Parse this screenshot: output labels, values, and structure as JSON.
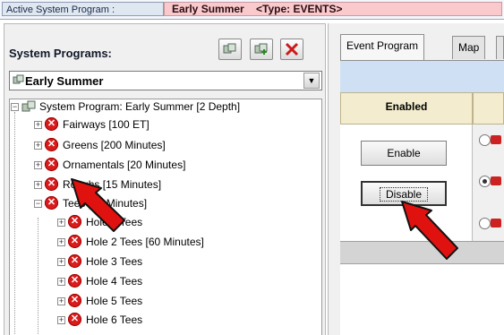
{
  "header": {
    "active_label": "Active System Program :",
    "active_value": "Early Summer    <Type: EVENTS>"
  },
  "left_panel": {
    "title": "System Programs:",
    "toolbar": [
      {
        "icon": "program-icon",
        "name": "view-program-button"
      },
      {
        "icon": "add-program-icon",
        "name": "add-program-button"
      },
      {
        "icon": "delete-x-icon",
        "name": "delete-program-button"
      }
    ],
    "selected_program": "Early Summer",
    "tree": [
      {
        "level": 0,
        "expander": "−",
        "icon": "program-icon",
        "text": "System Program: Early Summer  [2 Depth]"
      },
      {
        "level": 1,
        "expander": "+",
        "icon": "error-icon",
        "text": "Fairways  [100 ET]"
      },
      {
        "level": 1,
        "expander": "+",
        "icon": "error-icon",
        "text": "Greens  [200 Minutes]"
      },
      {
        "level": 1,
        "expander": "+",
        "icon": "error-icon",
        "text": "Ornamentals  [20 Minutes]"
      },
      {
        "level": 1,
        "expander": "+",
        "icon": "error-icon",
        "text": "Roughs  [15 Minutes]"
      },
      {
        "level": 1,
        "expander": "−",
        "icon": "error-icon",
        "text": "Tees  [35 Minutes]"
      },
      {
        "level": 2,
        "expander": "+",
        "icon": "error-icon",
        "text": "Hole 1 Tees"
      },
      {
        "level": 2,
        "expander": "+",
        "icon": "error-icon",
        "text": "Hole 2 Tees  [60 Minutes]"
      },
      {
        "level": 2,
        "expander": "+",
        "icon": "error-icon",
        "text": "Hole 3 Tees"
      },
      {
        "level": 2,
        "expander": "+",
        "icon": "error-icon",
        "text": "Hole 4 Tees"
      },
      {
        "level": 2,
        "expander": "+",
        "icon": "error-icon",
        "text": "Hole 5 Tees"
      },
      {
        "level": 2,
        "expander": "+",
        "icon": "error-icon",
        "text": "Hole 6 Tees"
      }
    ]
  },
  "right_panel": {
    "tabs": [
      "Event Program",
      "Map"
    ],
    "column_header": "Enabled",
    "enable_button": "Enable",
    "disable_button": "Disable"
  },
  "colors": {
    "active_value_bg": "#f9c9cc",
    "band_blue": "#cfe0f5",
    "header_tan": "#f4ecce",
    "error_red": "#d91b1b",
    "callout_arrow": "#e0120f"
  }
}
